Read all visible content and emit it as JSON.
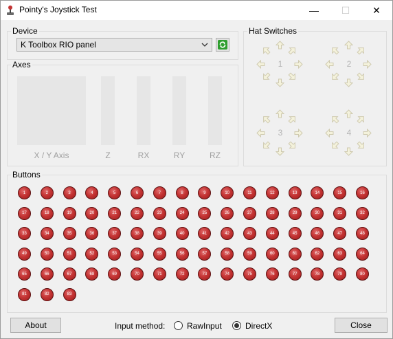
{
  "window": {
    "title": "Pointy's Joystick Test",
    "minimize_glyph": "—",
    "maximize_glyph": "☐",
    "close_glyph": "✕"
  },
  "device": {
    "group_label": "Device",
    "selected": "K Toolbox RIO panel",
    "refresh_icon": "refresh-icon"
  },
  "axes": {
    "group_label": "Axes",
    "labels": [
      "X / Y Axis",
      "Z",
      "RX",
      "RY",
      "RZ"
    ]
  },
  "hats": {
    "group_label": "Hat Switches",
    "items": [
      "1",
      "2",
      "3",
      "4"
    ]
  },
  "buttons": {
    "group_label": "Buttons",
    "items": [
      "1",
      "2",
      "3",
      "4",
      "5",
      "6",
      "7",
      "8",
      "9",
      "10",
      "11",
      "12",
      "13",
      "14",
      "15",
      "16",
      "17",
      "18",
      "19",
      "20",
      "21",
      "22",
      "23",
      "24",
      "25",
      "26",
      "27",
      "28",
      "29",
      "30",
      "31",
      "32",
      "33",
      "34",
      "35",
      "36",
      "37",
      "38",
      "39",
      "40",
      "41",
      "42",
      "43",
      "44",
      "45",
      "46",
      "47",
      "48",
      "49",
      "50",
      "51",
      "52",
      "53",
      "54",
      "55",
      "56",
      "57",
      "58",
      "59",
      "60",
      "61",
      "62",
      "63",
      "64",
      "65",
      "66",
      "67",
      "68",
      "69",
      "70",
      "71",
      "72",
      "73",
      "74",
      "75",
      "76",
      "77",
      "78",
      "79",
      "80",
      "81",
      "82",
      "83"
    ]
  },
  "footer": {
    "about_label": "About",
    "input_method_label": "Input method:",
    "rawinput_label": "RawInput",
    "directx_label": "DirectX",
    "selected_method": "DirectX",
    "close_label": "Close"
  },
  "colors": {
    "button_red": "#c43434",
    "refresh_green": "#2e9e2e",
    "disabled_gray": "#a0a0a0"
  }
}
